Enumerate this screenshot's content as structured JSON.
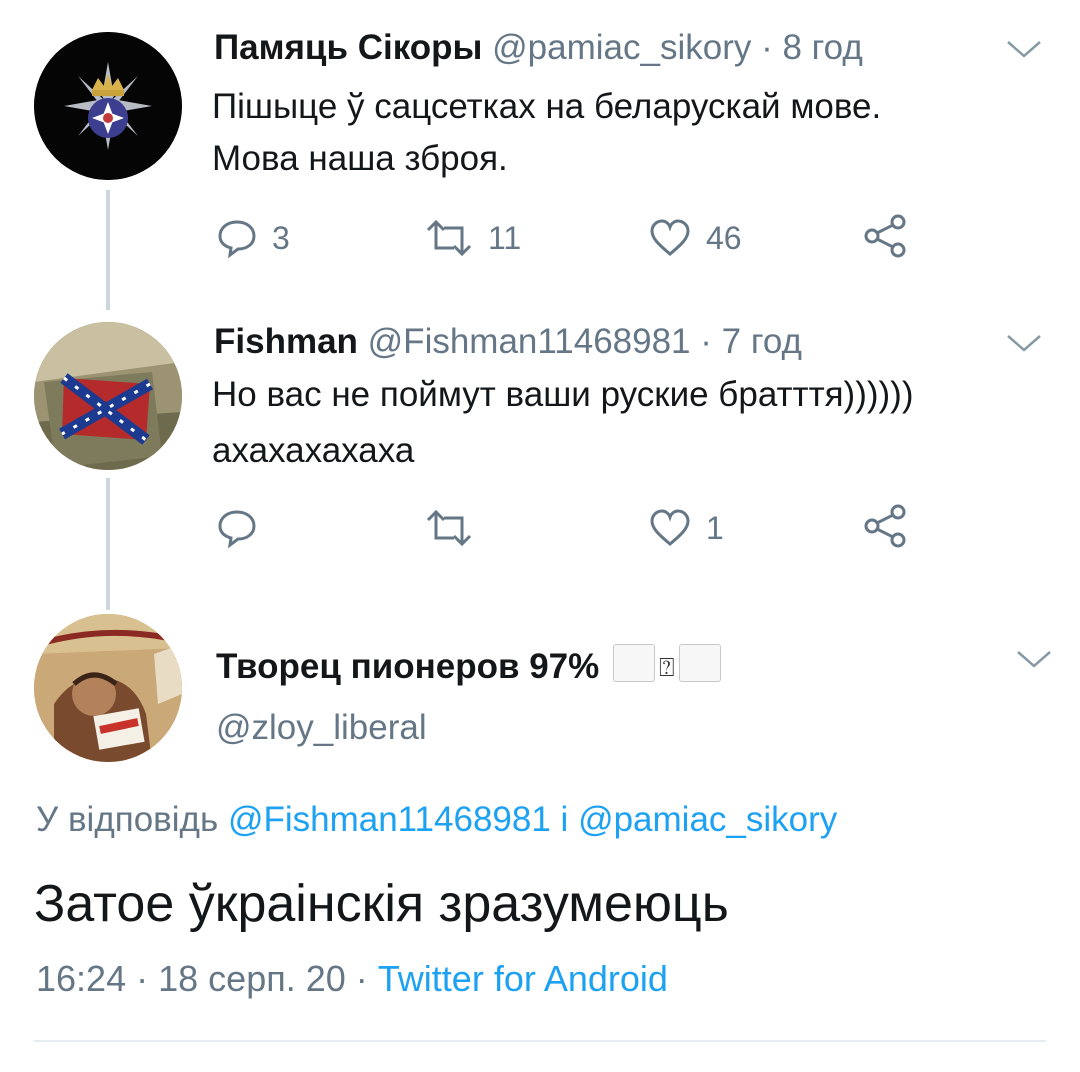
{
  "tweets": [
    {
      "name": "Памяць Сікоры",
      "handle": "@pamiac_sikory",
      "separator": " · ",
      "time": "8 год",
      "lines": [
        "Пішыце ў сацсетках на беларускай мове.",
        "Мова наша зброя."
      ],
      "replies": "3",
      "retweets": "11",
      "likes": "46"
    },
    {
      "name": "Fishman",
      "handle": "@Fishman11468981",
      "separator": " · ",
      "time": "7 год",
      "lines": [
        "Но вас не поймут ваши руские братття))))))",
        "ахахахахаха"
      ],
      "replies": "",
      "retweets": "",
      "likes": "1"
    }
  ],
  "focused": {
    "name": "Творец пионеров 97%",
    "name_glyph": "⍰",
    "handle": "@zloy_liberal",
    "reply_prefix": "У відповідь",
    "reply_user1": "@Fishman11468981",
    "reply_joiner": "і",
    "reply_user2": "@pamiac_sikory",
    "text": "Затое ўкраінскія зразумеюць",
    "time": "16:24",
    "date": "18 серп. 20",
    "dot": "·",
    "source": "Twitter for Android"
  },
  "colors": {
    "link": "#1da1f2",
    "meta": "#657786",
    "icon": "#657786",
    "thread_line": "#ccd6dd"
  },
  "icons": [
    "reply-icon",
    "retweet-icon",
    "like-icon",
    "share-icon",
    "chevron-down-icon"
  ]
}
